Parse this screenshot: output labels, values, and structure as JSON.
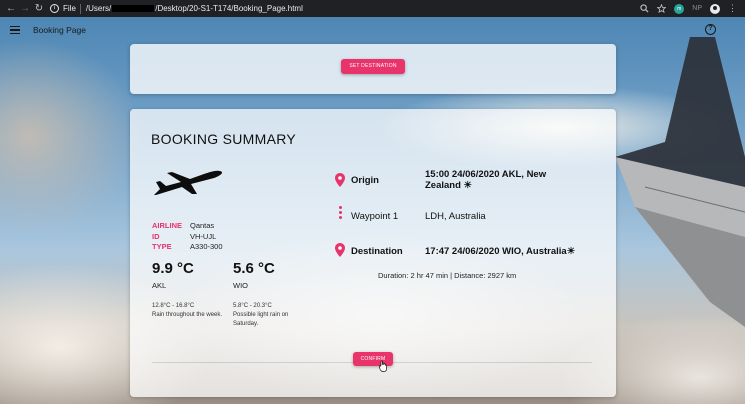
{
  "browser": {
    "file_label": "File",
    "path_prefix": "/Users/",
    "path_suffix": "/Desktop/20-S1-T174/Booking_Page.html",
    "ext_label": "m",
    "np_label": "NP"
  },
  "appbar": {
    "title": "Booking Page"
  },
  "top_card": {
    "set_destination_label": "SET DESTINATION"
  },
  "summary": {
    "title": "BOOKING SUMMARY",
    "flight": [
      {
        "key": "AIRLINE",
        "value": "Qantas"
      },
      {
        "key": "ID",
        "value": "VH-UJL"
      },
      {
        "key": "TYPE",
        "value": "A330-300"
      }
    ],
    "weather": {
      "origin": {
        "temp": "9.9 °C",
        "location": "AKL",
        "range": "12.8°C - 16.8°C",
        "desc": "Rain throughout the week."
      },
      "destination": {
        "temp": "5.6 °C",
        "location": "WIO",
        "range": "5.8°C - 20.3°C",
        "desc": "Possible light rain on Saturday."
      }
    },
    "route": {
      "origin_label": "Origin",
      "origin_value": "15:00 24/06/2020 AKL, New Zealand ☀",
      "waypoint_label": "Waypoint 1",
      "waypoint_value": "LDH, Australia",
      "destination_label": "Destination",
      "destination_value": "17:47 24/06/2020 WIO, Australia☀"
    },
    "duration_text": "Duration: 2 hr 47 min | Distance: 2927 km",
    "confirm_label": "CONFIRM"
  },
  "colors": {
    "accent": "#e8336b"
  }
}
